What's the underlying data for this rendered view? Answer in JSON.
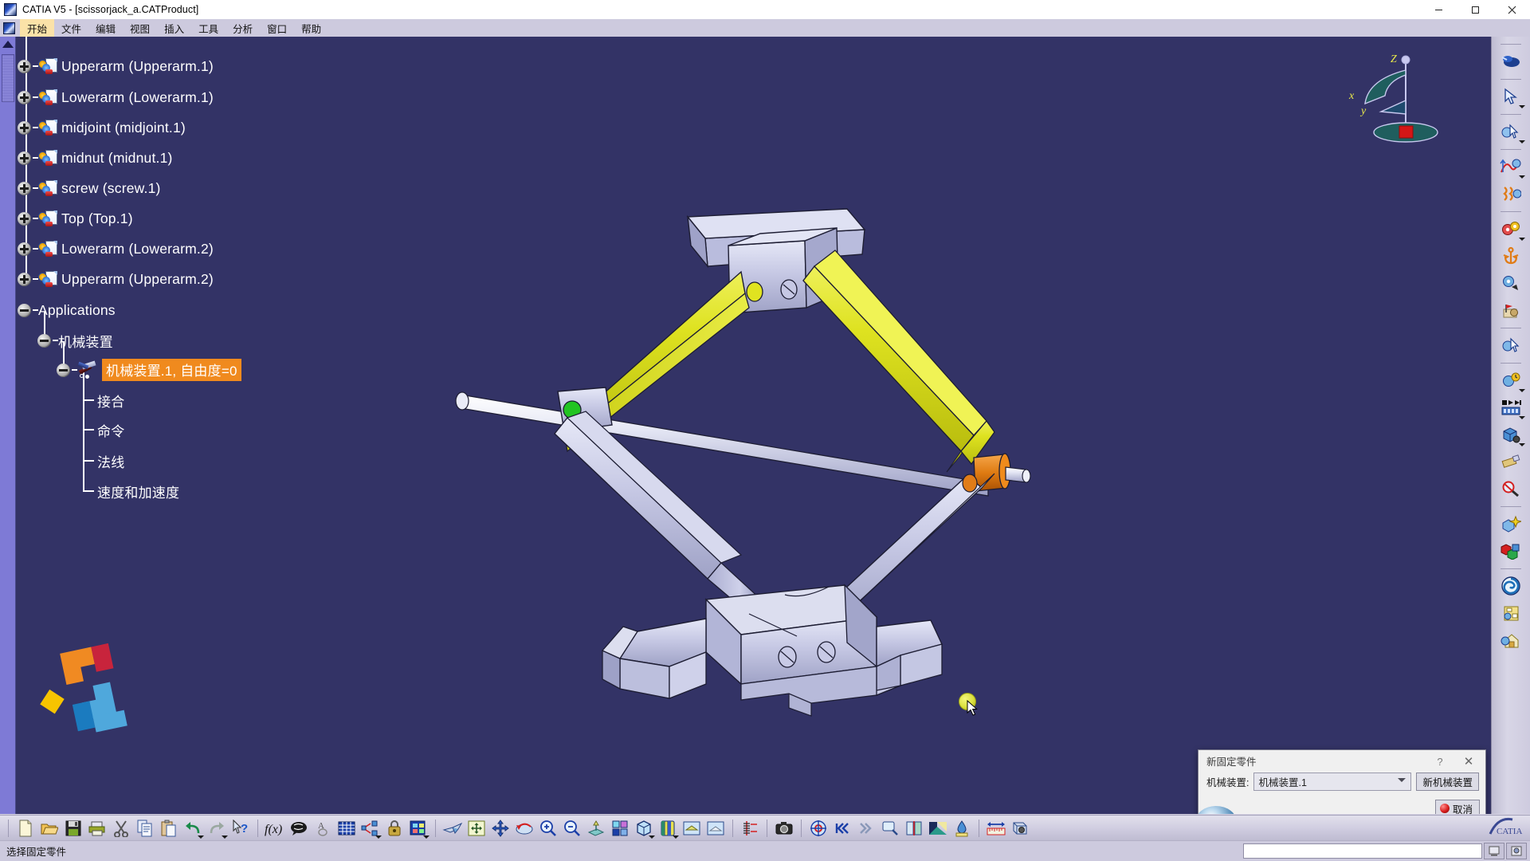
{
  "window": {
    "title": "CATIA V5 - [scissorjack_a.CATProduct]",
    "icon": "catia-app-icon",
    "buttons": {
      "minimize": "minimize-icon",
      "maximize": "maximize-icon",
      "close": "close-icon"
    }
  },
  "menubar": {
    "icon": "catia-doc-icon",
    "items": [
      {
        "label": "开始",
        "active": true
      },
      {
        "label": "文件",
        "active": false
      },
      {
        "label": "编辑",
        "active": false
      },
      {
        "label": "视图",
        "active": false
      },
      {
        "label": "插入",
        "active": false
      },
      {
        "label": "工具",
        "active": false
      },
      {
        "label": "分析",
        "active": false
      },
      {
        "label": "窗口",
        "active": false
      },
      {
        "label": "帮助",
        "active": false
      }
    ]
  },
  "tree": {
    "nodes": [
      {
        "label": "Upperarm (Upperarm.1)",
        "icon": "part-icon",
        "expander": "plus",
        "clipped": true
      },
      {
        "label": "Lowerarm (Lowerarm.1)",
        "icon": "part-icon",
        "expander": "plus"
      },
      {
        "label": "midjoint (midjoint.1)",
        "icon": "part-icon",
        "expander": "plus"
      },
      {
        "label": "midnut (midnut.1)",
        "icon": "part-icon",
        "expander": "plus"
      },
      {
        "label": "screw (screw.1)",
        "icon": "part-icon",
        "expander": "plus"
      },
      {
        "label": "Top (Top.1)",
        "icon": "part-icon",
        "expander": "plus"
      },
      {
        "label": "Lowerarm (Lowerarm.2)",
        "icon": "part-icon",
        "expander": "plus"
      },
      {
        "label": "Upperarm (Upperarm.2)",
        "icon": "part-icon",
        "expander": "plus"
      },
      {
        "label": "Applications",
        "icon": "none",
        "expander": "minus"
      },
      {
        "label": "机械装置",
        "icon": "none",
        "expander": "minus"
      },
      {
        "label": "机械装置.1, 自由度=0",
        "icon": "mechanism-icon",
        "expander": "minus",
        "selected": true
      },
      {
        "label": "接合",
        "icon": "none",
        "expander": "none"
      },
      {
        "label": "命令",
        "icon": "none",
        "expander": "none"
      },
      {
        "label": "法线",
        "icon": "none",
        "expander": "none"
      },
      {
        "label": "速度和加速度",
        "icon": "none",
        "expander": "none"
      }
    ]
  },
  "viewport": {
    "background_color": "#333366",
    "compass": {
      "z_label": "Z",
      "x_label": "x",
      "y_label": "y"
    },
    "model": {
      "name": "scissor-jack-assembly",
      "body_color": "#c2c4e0",
      "arm_color": "#d9dd1c",
      "nut_color": "#e07c18",
      "joint_marker_color": "#22c422"
    },
    "logo": {
      "name": "watermark-logo"
    },
    "hotspot": {
      "name": "selection-hotspot",
      "color": "#dbe03c"
    }
  },
  "dialog": {
    "title": "新固定零件",
    "help_label": "?",
    "close_label": "✕",
    "field_label": "机械装置:",
    "combo_value": "机械装置.1",
    "new_button": "新机械装置",
    "cancel_button": "取消"
  },
  "right_toolbar": {
    "items": [
      {
        "name": "fly-mode-icon",
        "glyph": "fly"
      },
      {
        "name": "select-arrow-icon",
        "glyph": "arrow",
        "chevron": true
      },
      {
        "name": "select-feature-icon",
        "glyph": "arrow-gear",
        "chevron": true
      },
      {
        "name": "simulation-curve-icon",
        "glyph": "curve-gear",
        "chevron": true
      },
      {
        "name": "mechanism-dressup-icon",
        "glyph": "spring-gear"
      },
      {
        "name": "new-mechanism-icon",
        "glyph": "gears",
        "chevron": true
      },
      {
        "name": "fixed-part-icon",
        "glyph": "anchor"
      },
      {
        "name": "assembly-constraint-icon",
        "glyph": "gear-pen"
      },
      {
        "name": "speed-accel-icon",
        "glyph": "flag-ball"
      },
      {
        "name": "kinematic-select-icon",
        "glyph": "gear-arrow"
      },
      {
        "name": "simulation-icon",
        "glyph": "gear-clock",
        "chevron": true
      },
      {
        "name": "replay-icon",
        "glyph": "film",
        "chevron": true
      },
      {
        "name": "compile-simulation-icon",
        "glyph": "cube-ball",
        "chevron": true
      },
      {
        "name": "measure-icon",
        "glyph": "measure-brush"
      },
      {
        "name": "clash-analysis-icon",
        "glyph": "magnifier-red"
      },
      {
        "name": "scene-icon",
        "glyph": "cube-star"
      },
      {
        "name": "material-icon",
        "glyph": "cubes-color"
      },
      {
        "name": "swept-volume-icon",
        "glyph": "spiral"
      },
      {
        "name": "options-icon",
        "glyph": "note-gear"
      },
      {
        "name": "home-icon",
        "glyph": "house-gear"
      }
    ]
  },
  "bottom_toolbar": {
    "items": [
      {
        "name": "new-document-icon",
        "glyph": "page"
      },
      {
        "name": "open-icon",
        "glyph": "folder"
      },
      {
        "name": "save-icon",
        "glyph": "floppy"
      },
      {
        "name": "print-icon",
        "glyph": "printer"
      },
      {
        "name": "cut-icon",
        "glyph": "scissors"
      },
      {
        "name": "copy-icon",
        "glyph": "copy"
      },
      {
        "name": "paste-icon",
        "glyph": "paste"
      },
      {
        "name": "undo-icon",
        "glyph": "undo",
        "chevron": true
      },
      {
        "name": "redo-icon",
        "glyph": "redo",
        "chevron": true
      },
      {
        "name": "whats-this-icon",
        "glyph": "arrow-question"
      },
      {
        "name": "formula-icon",
        "glyph": "fx"
      },
      {
        "name": "comment-icon",
        "glyph": "speech"
      },
      {
        "name": "annotation-icon",
        "glyph": "annotation"
      },
      {
        "name": "design-table-icon",
        "glyph": "grid"
      },
      {
        "name": "publication-icon",
        "glyph": "publish",
        "chevron": true
      },
      {
        "name": "lock-icon",
        "glyph": "lock"
      },
      {
        "name": "catalog-icon",
        "glyph": "catalog",
        "chevron": true
      },
      {
        "name": "fly-through-icon",
        "glyph": "fly2"
      },
      {
        "name": "fit-all-icon",
        "glyph": "fit"
      },
      {
        "name": "pan-icon",
        "glyph": "pan"
      },
      {
        "name": "rotate-icon",
        "glyph": "rotate"
      },
      {
        "name": "zoom-in-icon",
        "glyph": "zoom-in"
      },
      {
        "name": "zoom-out-icon",
        "glyph": "zoom-out"
      },
      {
        "name": "normal-view-icon",
        "glyph": "normal-view"
      },
      {
        "name": "multi-view-icon",
        "glyph": "quad"
      },
      {
        "name": "isometric-view-icon",
        "glyph": "cube",
        "chevron": true
      },
      {
        "name": "render-style-icon",
        "glyph": "shading",
        "chevron": true
      },
      {
        "name": "hide-show-icon",
        "glyph": "hide"
      },
      {
        "name": "swap-visible-icon",
        "glyph": "swap"
      },
      {
        "name": "axis-system-icon",
        "glyph": "ruler-axis"
      },
      {
        "name": "capture-icon",
        "glyph": "camera"
      },
      {
        "name": "apply-material-icon",
        "glyph": "target"
      },
      {
        "name": "first-step-icon",
        "glyph": "first"
      },
      {
        "name": "last-step-icon",
        "glyph": "last"
      },
      {
        "name": "magnifier-icon",
        "glyph": "magnifier"
      },
      {
        "name": "sectioning-icon",
        "glyph": "section"
      },
      {
        "name": "shading-material-icon",
        "glyph": "shade-mat"
      },
      {
        "name": "paint-drop-icon",
        "glyph": "droplet"
      },
      {
        "name": "distance-measure-icon",
        "glyph": "measure-dist"
      },
      {
        "name": "measure-item-icon",
        "glyph": "measure-item"
      }
    ]
  },
  "statusbar": {
    "message": "选择固定零件",
    "input_value": "",
    "mini_buttons": [
      {
        "name": "power-input-icon"
      },
      {
        "name": "user-session-icon"
      }
    ]
  }
}
